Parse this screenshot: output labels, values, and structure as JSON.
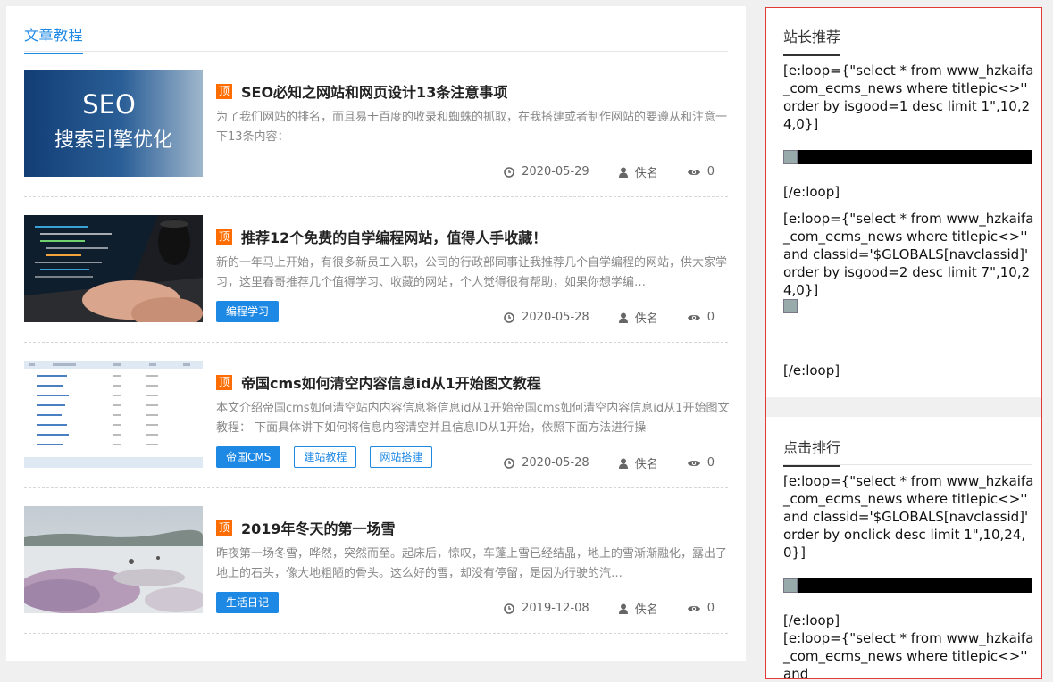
{
  "main": {
    "tab_label": "文章教程",
    "top_badge": "顶",
    "articles": [
      {
        "thumb_text_1": "SEO",
        "thumb_text_2": "搜索引擎优化",
        "title": "SEO必知之网站和网页设计13条注意事项",
        "summary": "为了我们网站的排名，而且易于百度的收录和蜘蛛的抓取，在我搭建或者制作网站的要遵从和注意一下13条内容：",
        "tags": [],
        "date": "2020-05-29",
        "author": "佚名",
        "views": "0"
      },
      {
        "title": "推荐12个免费的自学编程网站，值得人手收藏！",
        "summary": "新的一年马上开始，有很多新员工入职，公司的行政部同事让我推荐几个自学编程的网站，供大家学习，这里春哥推荐几个值得学习、收藏的网站，个人觉得很有帮助，如果你想学编…",
        "tags": [
          "编程学习"
        ],
        "date": "2020-05-28",
        "author": "佚名",
        "views": "0"
      },
      {
        "title": "帝国cms如何清空内容信息id从1开始图文教程",
        "summary": "本文介绍帝国cms如何清空站内内容信息将信息id从1开始帝国cms如何清空内容信息id从1开始图文教程： 下面具体讲下如何将信息内容清空并且信息ID从1开始，依照下面方法进行操",
        "tags": [
          "帝国CMS",
          "建站教程",
          "网站搭建"
        ],
        "date": "2020-05-28",
        "author": "佚名",
        "views": "0"
      },
      {
        "title": "2019年冬天的第一场雪",
        "summary": "昨夜第一场冬雪，哗然，突然而至。起床后，惊叹，车蓬上雪已经结晶，地上的雪渐渐融化，露出了地上的石头，像大地粗陋的骨头。这么好的雪，却没有停留，是因为行驶的汽…",
        "tags": [
          "生活日记"
        ],
        "date": "2019-12-08",
        "author": "佚名",
        "views": "0"
      }
    ]
  },
  "sidebar": {
    "recommend": {
      "title": "站长推荐",
      "code_1": "[e:loop={\"select * from www_hzkaifa_com_ecms_news where titlepic<>'' order by isgood=1 desc limit 1\",10,24,0}]",
      "end_1": "[/e:loop]",
      "code_2": "[e:loop={\"select * from www_hzkaifa_com_ecms_news where titlepic<>'' and classid='$GLOBALS[navclassid]' order by isgood=2 desc limit 7\",10,24,0}]",
      "end_2": "[/e:loop]"
    },
    "ranking": {
      "title": "点击排行",
      "code_1": "[e:loop={\"select * from www_hzkaifa_com_ecms_news where titlepic<>'' and classid='$GLOBALS[navclassid]' order by onclick desc limit 1\",10,24,0}]",
      "end_1": "[/e:loop]",
      "code_2": "[e:loop={\"select * from www_hzkaifa_com_ecms_news where titlepic<>'' and"
    }
  }
}
